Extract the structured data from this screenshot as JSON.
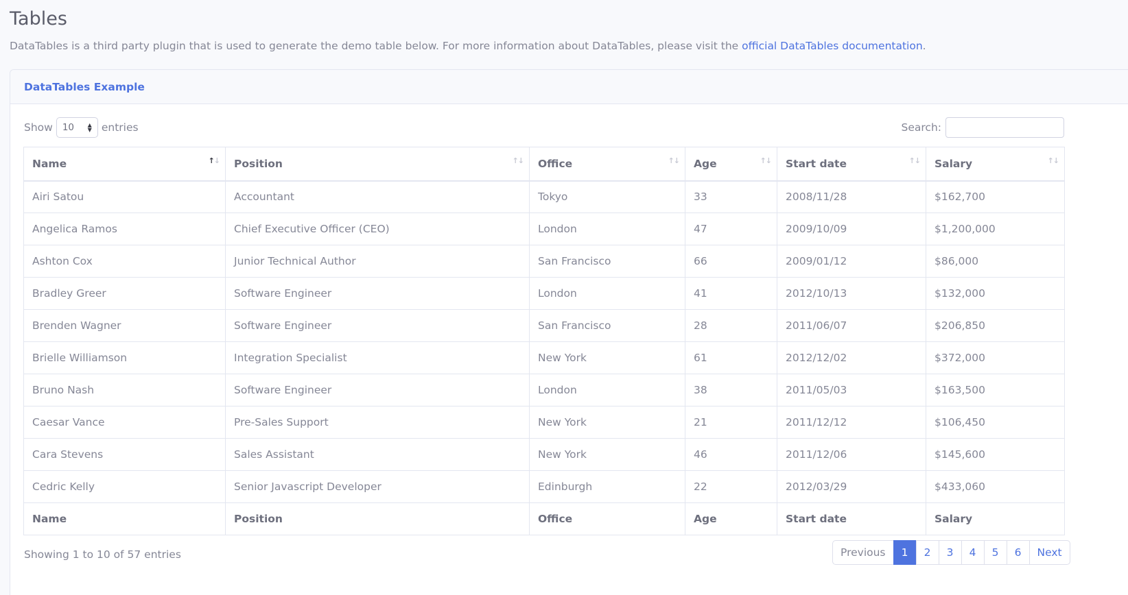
{
  "page": {
    "title": "Tables",
    "description_prefix": "DataTables is a third party plugin that is used to generate the demo table below. For more information about DataTables, please visit the ",
    "description_link": "official DataTables documentation",
    "description_suffix": "."
  },
  "card": {
    "header": "DataTables Example"
  },
  "length_control": {
    "show_label": "Show",
    "selected": "10",
    "entries_label": "entries"
  },
  "search": {
    "label": "Search:",
    "value": "",
    "placeholder": ""
  },
  "table": {
    "columns": [
      "Name",
      "Position",
      "Office",
      "Age",
      "Start date",
      "Salary"
    ],
    "rows": [
      [
        "Airi Satou",
        "Accountant",
        "Tokyo",
        "33",
        "2008/11/28",
        "$162,700"
      ],
      [
        "Angelica Ramos",
        "Chief Executive Officer (CEO)",
        "London",
        "47",
        "2009/10/09",
        "$1,200,000"
      ],
      [
        "Ashton Cox",
        "Junior Technical Author",
        "San Francisco",
        "66",
        "2009/01/12",
        "$86,000"
      ],
      [
        "Bradley Greer",
        "Software Engineer",
        "London",
        "41",
        "2012/10/13",
        "$132,000"
      ],
      [
        "Brenden Wagner",
        "Software Engineer",
        "San Francisco",
        "28",
        "2011/06/07",
        "$206,850"
      ],
      [
        "Brielle Williamson",
        "Integration Specialist",
        "New York",
        "61",
        "2012/12/02",
        "$372,000"
      ],
      [
        "Bruno Nash",
        "Software Engineer",
        "London",
        "38",
        "2011/05/03",
        "$163,500"
      ],
      [
        "Caesar Vance",
        "Pre-Sales Support",
        "New York",
        "21",
        "2011/12/12",
        "$106,450"
      ],
      [
        "Cara Stevens",
        "Sales Assistant",
        "New York",
        "46",
        "2011/12/06",
        "$145,600"
      ],
      [
        "Cedric Kelly",
        "Senior Javascript Developer",
        "Edinburgh",
        "22",
        "2012/03/29",
        "$433,060"
      ]
    ],
    "sort_icon": "sort-arrows-icon",
    "sorted_column": "Name",
    "sort_direction": "ascending"
  },
  "footer": {
    "info": "Showing 1 to 10 of 57 entries",
    "previous": "Previous",
    "pages": [
      "1",
      "2",
      "3",
      "4",
      "5",
      "6"
    ],
    "active_page": "1",
    "next": "Next"
  },
  "colors": {
    "primary": "#4e73df",
    "text": "#858796",
    "heading": "#6e707e",
    "border": "#e3e6f0",
    "background": "#f8f9fc"
  }
}
